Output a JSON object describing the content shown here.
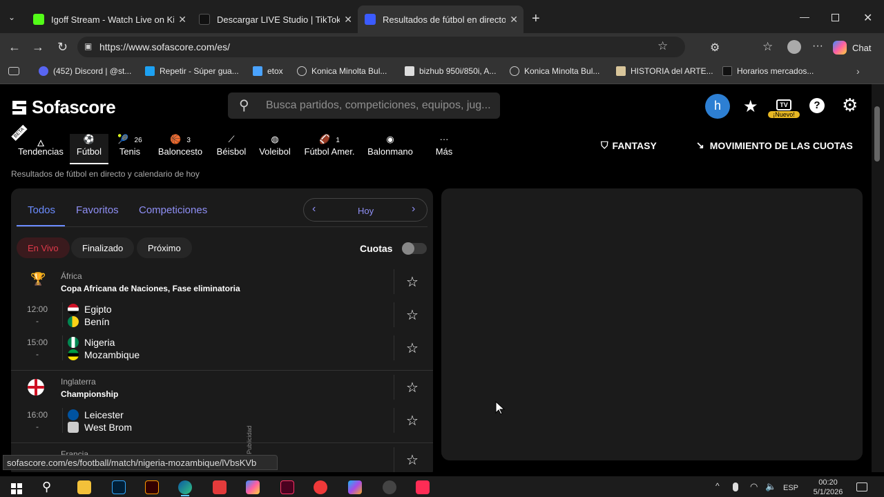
{
  "browser": {
    "tabs": [
      {
        "title": "Igoff Stream - Watch Live on Kick",
        "color": "#53fc18"
      },
      {
        "title": "Descargar LIVE Studio | TikTok",
        "color": "#111111"
      },
      {
        "title": "Resultados de fútbol en directo, ca",
        "color": "#3b5bff"
      }
    ],
    "url": "https://www.sofascore.com/es/",
    "copilot_label": "Chat",
    "bookmarks": [
      "(452) Discord | @st...",
      "Repetir - Súper gua...",
      "etox",
      "Konica Minolta Bul...",
      "bizhub 950i/850i, A...",
      "Konica Minolta Bul...",
      "HISTORIA del ARTE...",
      "Horarios mercados..."
    ],
    "status_url": "sofascore.com/es/football/match/nigeria-mozambique/lVbsKVb"
  },
  "header": {
    "logo_text": "Sofascore",
    "search_placeholder": "Busca partidos, competiciones, equipos, jug...",
    "avatar_letter": "h",
    "tv_badge": "¡Nuevo!",
    "tv_label": "TV"
  },
  "sports": [
    {
      "label": "Tendencias",
      "badge": "BETA",
      "count": ""
    },
    {
      "label": "Fútbol",
      "count": ""
    },
    {
      "label": "Tenis",
      "count": "26"
    },
    {
      "label": "Baloncesto",
      "count": "3"
    },
    {
      "label": "Béisbol",
      "count": ""
    },
    {
      "label": "Voleibol",
      "count": ""
    },
    {
      "label": "Fútbol Amer.",
      "count": "1"
    },
    {
      "label": "Balonmano",
      "count": ""
    },
    {
      "label": "Más",
      "count": ""
    }
  ],
  "fantasy_label": "FANTASY",
  "odds_movement_label": "MOVIMIENTO DE LAS CUOTAS",
  "subtitle": "Resultados de fútbol en directo y calendario de hoy",
  "tabs": {
    "all": "Todos",
    "favorites": "Favoritos",
    "competitions": "Competiciones",
    "date": "Hoy"
  },
  "filters": {
    "live": "En Vivo",
    "finished": "Finalizado",
    "upcoming": "Próximo",
    "odds": "Cuotas"
  },
  "ad_label": "Publicidad",
  "competitions": [
    {
      "region": "África",
      "name": "Copa Africana de Naciones, Fase eliminatoria",
      "matches": [
        {
          "time": "12:00",
          "status": "-",
          "home": "Egipto",
          "away": "Benín",
          "home_flag": "#ce1126",
          "away_flag": "#fcd116"
        },
        {
          "time": "15:00",
          "status": "-",
          "home": "Nigeria",
          "away": "Mozambique",
          "home_flag": "#008751",
          "away_flag": "#d21034"
        }
      ]
    },
    {
      "region": "Inglaterra",
      "name": "Championship",
      "matches": [
        {
          "time": "16:00",
          "status": "-",
          "home": "Leicester",
          "away": "West Brom",
          "home_flag": "#0053a0",
          "away_flag": "#cccccc"
        }
      ]
    },
    {
      "region": "Francia",
      "name": "",
      "matches": []
    }
  ],
  "system": {
    "lang": "ESP",
    "time": "00:20",
    "date": "5/1/2026"
  }
}
